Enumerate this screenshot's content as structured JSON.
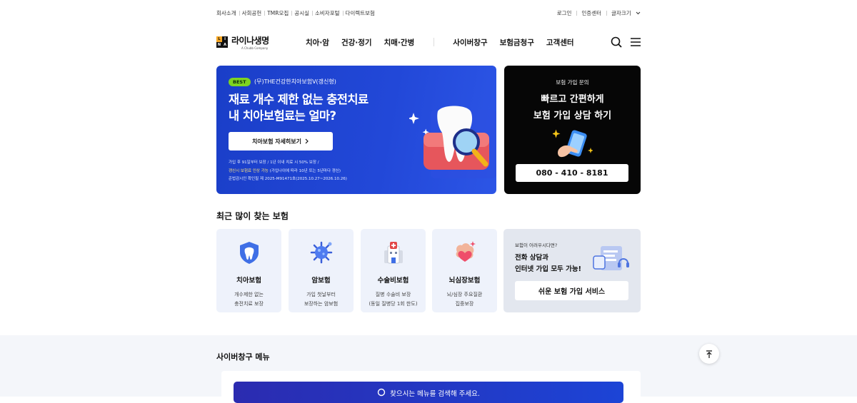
{
  "topbar": {
    "left": [
      "회사소개",
      "사회공헌",
      "TMR모집",
      "공시실",
      "소비자포털",
      "다이렉트보험"
    ],
    "login": "로그인",
    "cert": "인증센터",
    "font_size": "글자크기"
  },
  "header": {
    "logo_name": "라이나생명",
    "logo_sub": "A Chubb Company",
    "logo_mark": [
      "L",
      "I",
      "N",
      "A"
    ],
    "nav": [
      "치아·암",
      "건강·정기",
      "치매·간병",
      "사이버창구",
      "보험금청구",
      "고객센터"
    ]
  },
  "hero": {
    "badge": "BEST",
    "product": "(무)THE건강한치아보험V(갱신형)",
    "headline_1": "재료 개수 제한 없는 충전치료",
    "headline_2": "내 치아보험료는 얼마?",
    "cta": "치아보험 자세히보기",
    "fine_1": "가입 후 91일부터 보장 / 1년 이내 치료 시 50% 보장 /",
    "fine_2_hl": "갱신시 보험료 인상 가능",
    "fine_2_rest": " (가입나이에 따라 10년 또는 5년마다 갱신)",
    "fine_3": "준법감시인 확인필 제 2025-M91471호(2025.10.27~2026.10.26)"
  },
  "consult": {
    "label": "보험 가입 문의",
    "title_1": "빠르고 간편하게",
    "title_2": "보험 가입 상담 하기",
    "phone": "080 - 410 - 8181"
  },
  "popular": {
    "title": "최근 많이 찾는 보험",
    "cards": [
      {
        "name": "치아보험",
        "desc_1": "개수제한 없는",
        "desc_2": "충전치료 보장"
      },
      {
        "name": "암보험",
        "desc_1": "가입 첫날부터",
        "desc_2": "보장하는 암보험"
      },
      {
        "name": "수술비보험",
        "desc_1": "질병 수술비 보장",
        "desc_2": "(동일 질병당 1회 한도)"
      },
      {
        "name": "뇌심장보험",
        "desc_1": "뇌/심장 주요질환",
        "desc_2": "집중보장"
      }
    ],
    "help": {
      "question": "보험이 어려우시다면?",
      "answer_1": "전화 상담과",
      "answer_2": "인터넷 가입 모두 가능!",
      "button": "쉬운 보험 가입 서비스"
    }
  },
  "cyber": {
    "title": "사이버창구 메뉴",
    "search_placeholder": "찾으시는 메뉴를 검색해 주세요."
  },
  "colors": {
    "hero_blue": "#2248d8",
    "badge_green": "#7ed321",
    "card_bg": "#eef2fb"
  }
}
